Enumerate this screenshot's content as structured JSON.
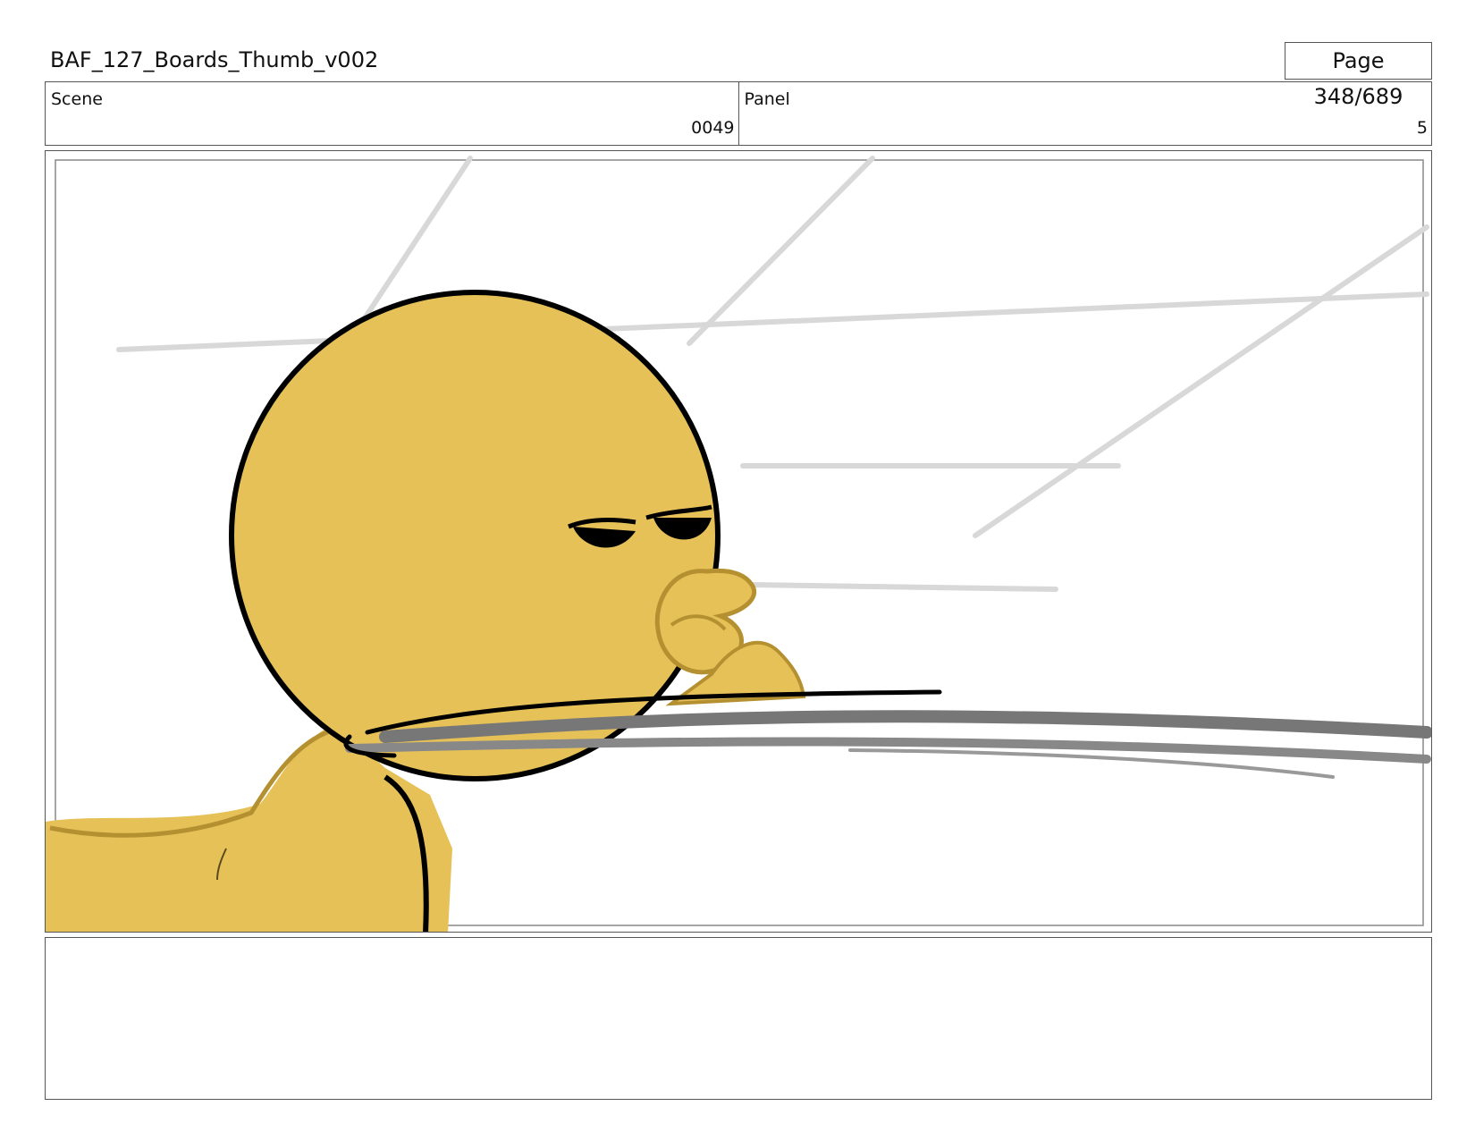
{
  "header": {
    "title": "BAF_127_Boards_Thumb_v002",
    "page_indicator": "Page 348/689"
  },
  "fields": {
    "scene_label": "Scene",
    "scene_value": "0049",
    "panel_label": "Panel",
    "panel_value": "5"
  },
  "illustration": {
    "character_color": "#E6C158",
    "shadow_color": "#B59030",
    "outline_color": "#000000",
    "speed_line_color": "#D8D8D8",
    "streak_color": "#777777"
  },
  "notes": {
    "text": ""
  }
}
